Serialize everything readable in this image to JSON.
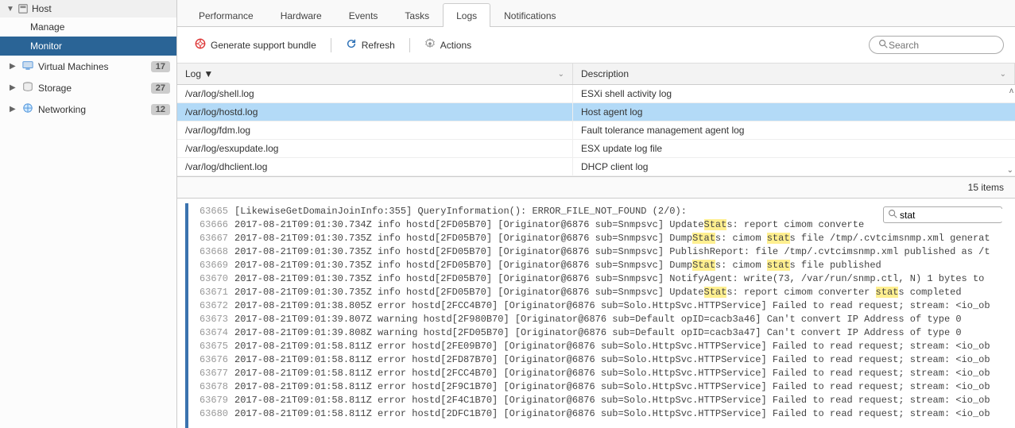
{
  "sidebar": {
    "host_label": "Host",
    "manage": "Manage",
    "monitor": "Monitor",
    "nav": [
      {
        "label": "Virtual Machines",
        "badge": "17"
      },
      {
        "label": "Storage",
        "badge": "27"
      },
      {
        "label": "Networking",
        "badge": "12"
      }
    ]
  },
  "tabs": [
    "Performance",
    "Hardware",
    "Events",
    "Tasks",
    "Logs",
    "Notifications"
  ],
  "active_tab_index": 4,
  "toolbar": {
    "support": "Generate support bundle",
    "refresh": "Refresh",
    "actions": "Actions",
    "search_placeholder": "Search"
  },
  "grid": {
    "col1": "Log",
    "col2": "Description",
    "rows": [
      {
        "log": "/var/log/shell.log",
        "desc": "ESXi shell activity log",
        "selected": false
      },
      {
        "log": "/var/log/hostd.log",
        "desc": "Host agent log",
        "selected": true
      },
      {
        "log": "/var/log/fdm.log",
        "desc": "Fault tolerance management agent log",
        "selected": false
      },
      {
        "log": "/var/log/esxupdate.log",
        "desc": "ESX update log file",
        "selected": false
      },
      {
        "log": "/var/log/dhclient.log",
        "desc": "DHCP client log",
        "selected": false
      }
    ],
    "footer": "15 items"
  },
  "log_filter": {
    "value": "stat"
  },
  "log_lines": [
    {
      "n": "63665",
      "segs": [
        {
          "t": "[LikewiseGetDomainJoinInfo:355] QueryInformation(): ERROR_FILE_NOT_FOUND (2/0):"
        }
      ]
    },
    {
      "n": "63666",
      "segs": [
        {
          "t": "2017-08-21T09:01:30.734Z info hostd[2FD05B70] [Originator@6876 sub=Snmpsvc] Update"
        },
        {
          "t": "Stat",
          "h": true
        },
        {
          "t": "s: report cimom converte"
        }
      ]
    },
    {
      "n": "63667",
      "segs": [
        {
          "t": "2017-08-21T09:01:30.735Z info hostd[2FD05B70] [Originator@6876 sub=Snmpsvc] Dump"
        },
        {
          "t": "Stat",
          "h": true
        },
        {
          "t": "s: cimom "
        },
        {
          "t": "stat",
          "h": true
        },
        {
          "t": "s file /tmp/.cvtcimsnmp.xml generat"
        }
      ]
    },
    {
      "n": "63668",
      "segs": [
        {
          "t": "2017-08-21T09:01:30.735Z info hostd[2FD05B70] [Originator@6876 sub=Snmpsvc] PublishReport: file /tmp/.cvtcimsnmp.xml published as /t"
        }
      ]
    },
    {
      "n": "63669",
      "segs": [
        {
          "t": "2017-08-21T09:01:30.735Z info hostd[2FD05B70] [Originator@6876 sub=Snmpsvc] Dump"
        },
        {
          "t": "Stat",
          "h": true
        },
        {
          "t": "s: cimom "
        },
        {
          "t": "stat",
          "h": true
        },
        {
          "t": "s file published"
        }
      ]
    },
    {
      "n": "63670",
      "segs": [
        {
          "t": "2017-08-21T09:01:30.735Z info hostd[2FD05B70] [Originator@6876 sub=Snmpsvc] NotifyAgent: write(73, /var/run/snmp.ctl, N) 1 bytes to"
        }
      ]
    },
    {
      "n": "63671",
      "segs": [
        {
          "t": "2017-08-21T09:01:30.735Z info hostd[2FD05B70] [Originator@6876 sub=Snmpsvc] Update"
        },
        {
          "t": "Stat",
          "h": true
        },
        {
          "t": "s: report cimom converter "
        },
        {
          "t": "stat",
          "h": true
        },
        {
          "t": "s completed"
        }
      ]
    },
    {
      "n": "63672",
      "segs": [
        {
          "t": "2017-08-21T09:01:38.805Z error hostd[2FCC4B70] [Originator@6876 sub=Solo.HttpSvc.HTTPService] Failed to read request; stream: <io_ob"
        }
      ]
    },
    {
      "n": "63673",
      "segs": [
        {
          "t": "2017-08-21T09:01:39.807Z warning hostd[2F980B70] [Originator@6876 sub=Default opID=cacb3a46] Can't convert IP Address of type 0"
        }
      ]
    },
    {
      "n": "63674",
      "segs": [
        {
          "t": "2017-08-21T09:01:39.808Z warning hostd[2FD05B70] [Originator@6876 sub=Default opID=cacb3a47] Can't convert IP Address of type 0"
        }
      ]
    },
    {
      "n": "63675",
      "segs": [
        {
          "t": "2017-08-21T09:01:58.811Z error hostd[2FE09B70] [Originator@6876 sub=Solo.HttpSvc.HTTPService] Failed to read request; stream: <io_ob"
        }
      ]
    },
    {
      "n": "63676",
      "segs": [
        {
          "t": "2017-08-21T09:01:58.811Z error hostd[2FD87B70] [Originator@6876 sub=Solo.HttpSvc.HTTPService] Failed to read request; stream: <io_ob"
        }
      ]
    },
    {
      "n": "63677",
      "segs": [
        {
          "t": "2017-08-21T09:01:58.811Z error hostd[2FCC4B70] [Originator@6876 sub=Solo.HttpSvc.HTTPService] Failed to read request; stream: <io_ob"
        }
      ]
    },
    {
      "n": "63678",
      "segs": [
        {
          "t": "2017-08-21T09:01:58.811Z error hostd[2F9C1B70] [Originator@6876 sub=Solo.HttpSvc.HTTPService] Failed to read request; stream: <io_ob"
        }
      ]
    },
    {
      "n": "63679",
      "segs": [
        {
          "t": "2017-08-21T09:01:58.811Z error hostd[2F4C1B70] [Originator@6876 sub=Solo.HttpSvc.HTTPService] Failed to read request; stream: <io_ob"
        }
      ]
    },
    {
      "n": "63680",
      "segs": [
        {
          "t": "2017-08-21T09:01:58.811Z error hostd[2DFC1B70] [Originator@6876 sub=Solo.HttpSvc.HTTPService] Failed to read request; stream: <io_ob"
        }
      ]
    }
  ]
}
